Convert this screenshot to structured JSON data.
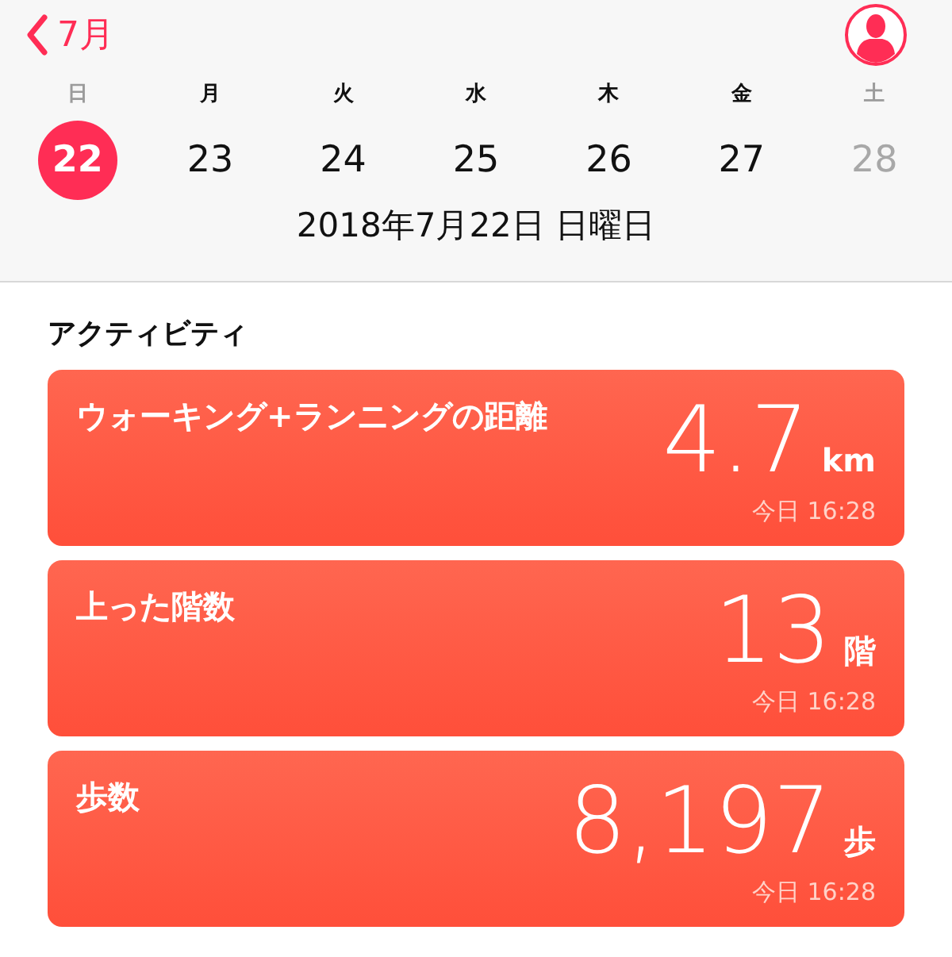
{
  "nav": {
    "back_label": "7月"
  },
  "weekdays": [
    {
      "label": "日",
      "weekend": true
    },
    {
      "label": "月",
      "weekend": false
    },
    {
      "label": "火",
      "weekend": false
    },
    {
      "label": "水",
      "weekend": false
    },
    {
      "label": "木",
      "weekend": false
    },
    {
      "label": "金",
      "weekend": false
    },
    {
      "label": "土",
      "weekend": true
    }
  ],
  "days": [
    {
      "label": "22",
      "selected": true,
      "disabled": false
    },
    {
      "label": "23",
      "selected": false,
      "disabled": false
    },
    {
      "label": "24",
      "selected": false,
      "disabled": false
    },
    {
      "label": "25",
      "selected": false,
      "disabled": false
    },
    {
      "label": "26",
      "selected": false,
      "disabled": false
    },
    {
      "label": "27",
      "selected": false,
      "disabled": false
    },
    {
      "label": "28",
      "selected": false,
      "disabled": true
    }
  ],
  "date_title": "2018年7月22日 日曜日",
  "section_title": "アクティビティ",
  "cards": [
    {
      "title": "ウォーキング+ランニングの距離",
      "value": "4.7",
      "unit": "km",
      "time": "今日 16:28"
    },
    {
      "title": "上った階数",
      "value": "13",
      "unit": "階",
      "time": "今日 16:28"
    },
    {
      "title": "歩数",
      "value": "8,197",
      "unit": "歩",
      "time": "今日 16:28"
    }
  ]
}
